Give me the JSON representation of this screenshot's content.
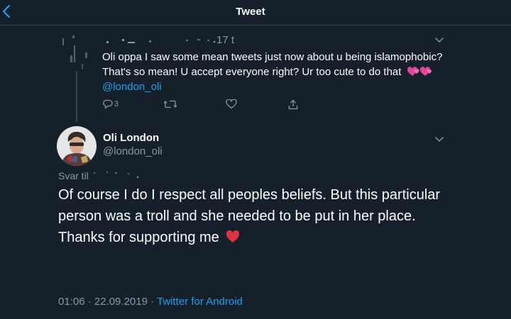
{
  "header": {
    "title": "Tweet"
  },
  "icons": {
    "back": "chevron-left-icon",
    "more": "chevron-down-icon",
    "reply": "reply-icon",
    "retweet": "retweet-icon",
    "like": "heart-icon",
    "share": "share-icon"
  },
  "colors": {
    "background": "#15202b",
    "divider": "#38444d",
    "accent": "#1da1f2",
    "secondary_text": "#8899a6",
    "primary_text": "#ffffff"
  },
  "parent_tweet": {
    "time": "17 t",
    "text": "Oli oppa I saw some mean tweets just now about u being islamophobic? That's so mean! U accept everyone right? Ur too cute to do that",
    "mention": "@london_oli",
    "reply_count": "3"
  },
  "main_tweet": {
    "name": "Oli London",
    "handle": "@london_oli",
    "reply_to_label": "Svar til",
    "text": "Of course I do I respect all peoples beliefs. But this particular person was a troll and she needed to be put in her place. Thanks for supporting me",
    "timestamp": "01:06 · 22.09.2019 · ",
    "source": "Twitter for Android"
  }
}
